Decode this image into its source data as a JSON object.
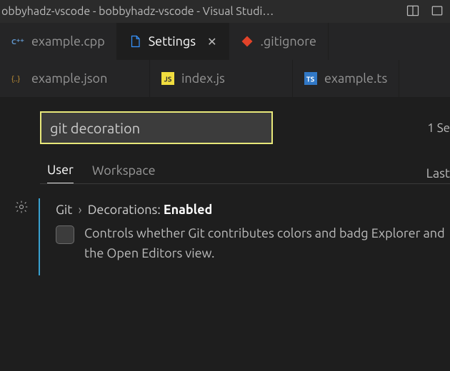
{
  "titlebar": {
    "title": "obbyhadz-vscode - bobbyhadz-vscode - Visual Studi…"
  },
  "tabs_row1": [
    {
      "label": "example.cpp",
      "icon": "cpp",
      "active": false,
      "close": false
    },
    {
      "label": "Settings",
      "icon": "settings-file",
      "active": true,
      "close": true
    },
    {
      "label": ".gitignore",
      "icon": "git",
      "active": false,
      "close": false
    }
  ],
  "tabs_row2": [
    {
      "label": "example.json",
      "icon": "json",
      "active": false
    },
    {
      "label": "index.js",
      "icon": "js",
      "active": false
    },
    {
      "label": "example.ts",
      "icon": "ts",
      "active": false
    }
  ],
  "settings": {
    "search_value": "git decoration",
    "search_count": "1 Se",
    "scopes": {
      "user": "User",
      "workspace": "Workspace",
      "right": "Last"
    },
    "item": {
      "category": "Git",
      "chevron": "›",
      "key": "Decorations:",
      "state": "Enabled",
      "description": "Controls whether Git contributes colors and badg  Explorer and the Open Editors view."
    }
  },
  "colors": {
    "highlight_border": "#e8e87a",
    "accent": "#39a0cf"
  }
}
